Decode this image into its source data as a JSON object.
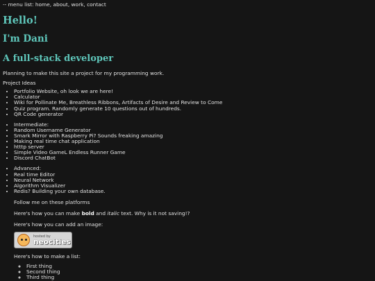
{
  "menu_text": "-- menu list: home, about, work, contact",
  "headings": {
    "hello": "Hello!",
    "name": "I'm Dani",
    "role": "A full-stack developer"
  },
  "planning": "Planning to make this site a project for my programming work.",
  "project_ideas_label": "Project Ideas",
  "list_beginner": [
    "Portfolio Website, oh look we are here!",
    "Calculator",
    "Wiki for Pollinate Me, Breathless Ribbons, Artifacts of Desire and Review to Come",
    "Quiz program. Randomly generate 10 questions out of hundreds.",
    "QR Code generator"
  ],
  "list_intermediate": [
    "Intermediate:",
    "Random Username Generator",
    "Smark Mirror with Raspberry Pi? Sounds freaking amazing",
    "Making real time chat application",
    "htttp server",
    "Simple Video GameL Endless Runner Game",
    "Discord ChatBot"
  ],
  "list_advanced": [
    "Advanced:",
    "Real time Editor",
    "Neural Network",
    "Algorithm Visualizer",
    "Redis? Building your own database."
  ],
  "follow_text": "Follow me on these platforms",
  "rich_text": {
    "before": "Here's how you can make ",
    "bold": "bold",
    "middle": " and ",
    "italic": "italic",
    "after": " text. Why is it not saving!?"
  },
  "image_intro": "Here's how you can add an image:",
  "badge": {
    "hosted_by": "hosted by",
    "brand": "neocities"
  },
  "list_intro": "Here's how to make a list:",
  "sublist": [
    "First thing",
    "Second thing",
    "Third thing"
  ]
}
